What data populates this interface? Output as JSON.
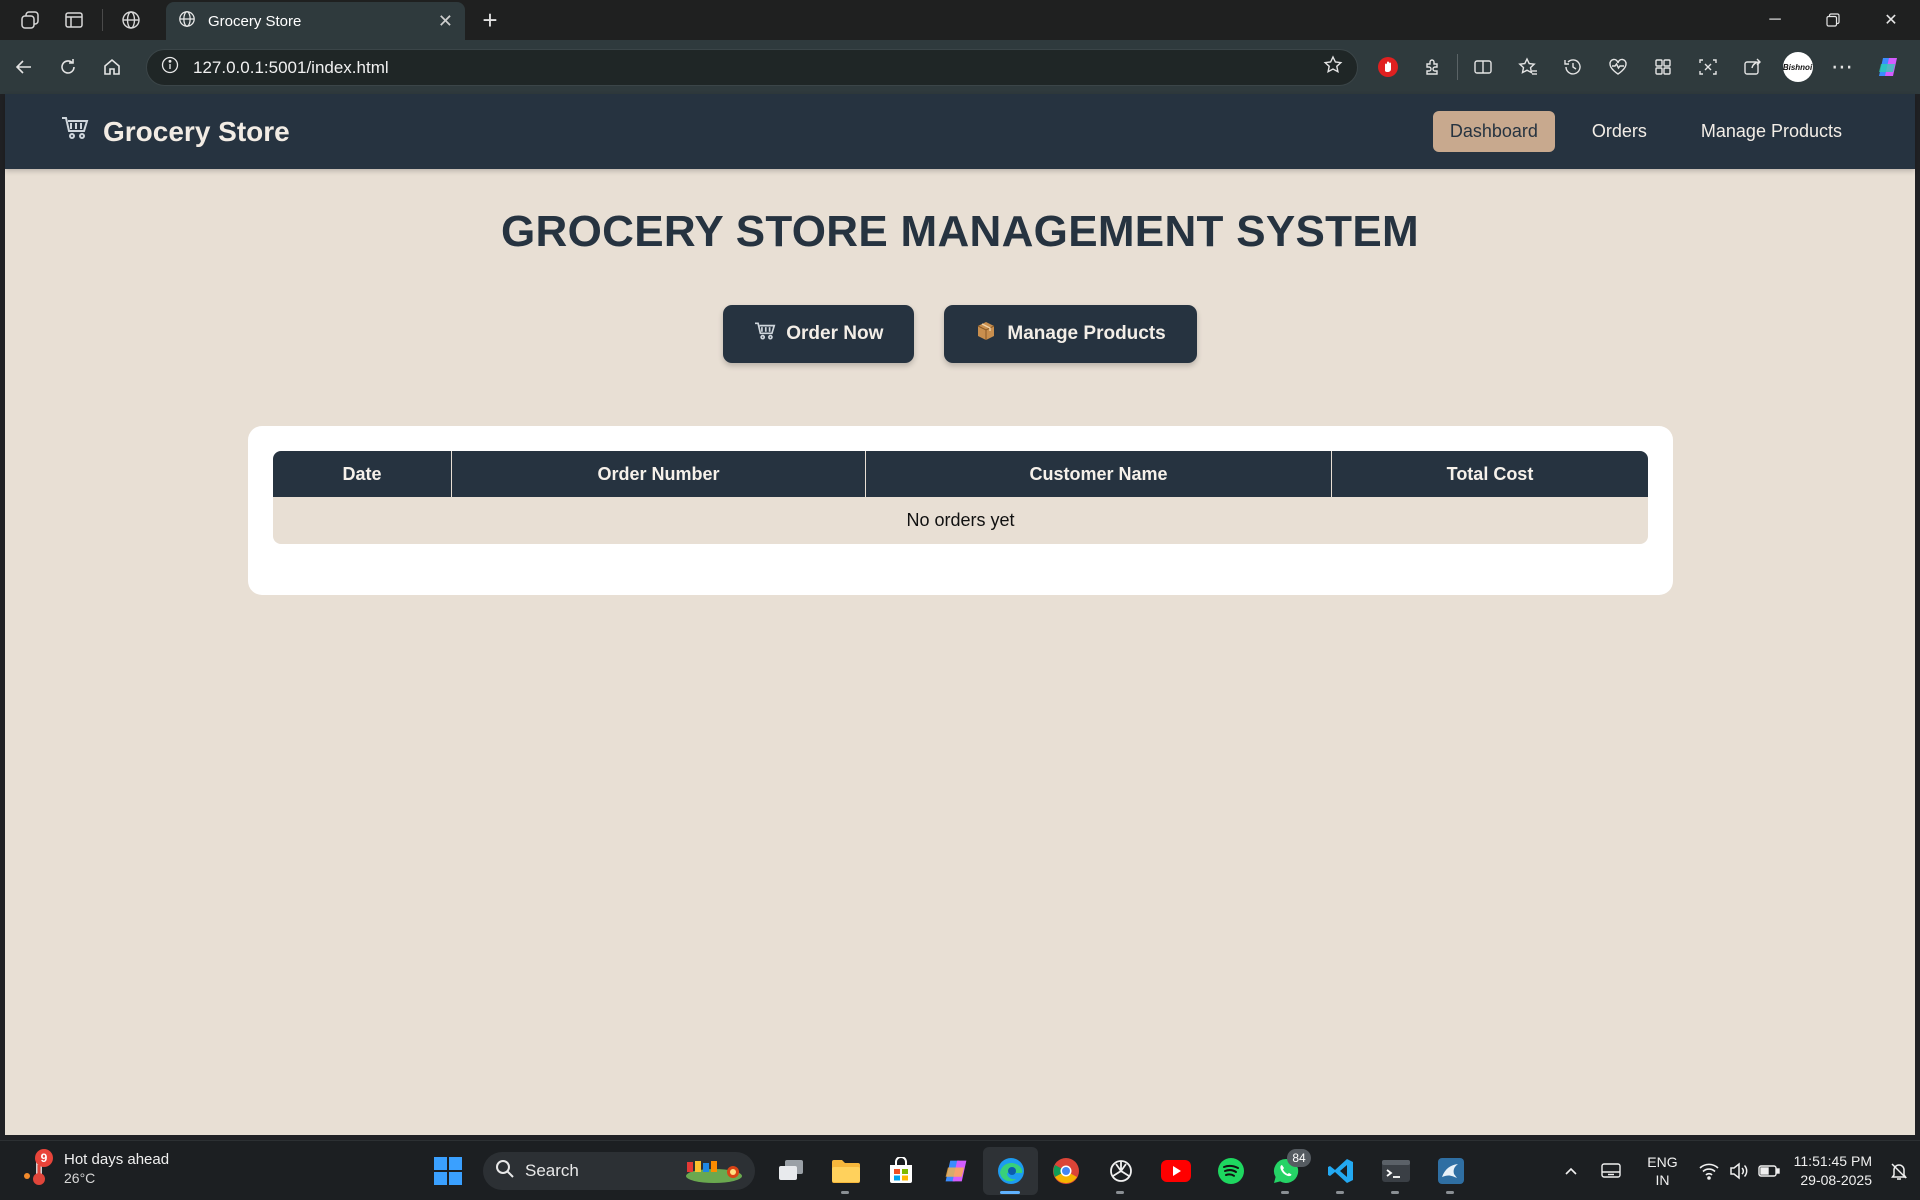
{
  "browser": {
    "tab_title": "Grocery Store",
    "address_url": "127.0.0.1:5001/index.html",
    "profile_badge": "Bishnoi"
  },
  "site": {
    "brand": "Grocery Store",
    "nav": {
      "dashboard": "Dashboard",
      "orders": "Orders",
      "manage_products": "Manage Products"
    },
    "headline": "GROCERY STORE MANAGEMENT SYSTEM",
    "buttons": {
      "order_now": "Order Now",
      "manage_products": "Manage Products"
    },
    "table": {
      "columns": [
        "Date",
        "Order Number",
        "Customer Name",
        "Total Cost"
      ],
      "empty_message": "No orders yet"
    }
  },
  "taskbar": {
    "weather_badge": "9",
    "weather_title": "Hot days ahead",
    "weather_temp": "26°C",
    "search_label": "Search",
    "whatsapp_badge": "84",
    "lang_line1": "ENG",
    "lang_line2": "IN",
    "time": "11:51:45 PM",
    "date": "29-08-2025"
  },
  "colors": {
    "navbar": "#263340",
    "page_bg": "#e8dfd4",
    "accent": "#c8a98e"
  }
}
